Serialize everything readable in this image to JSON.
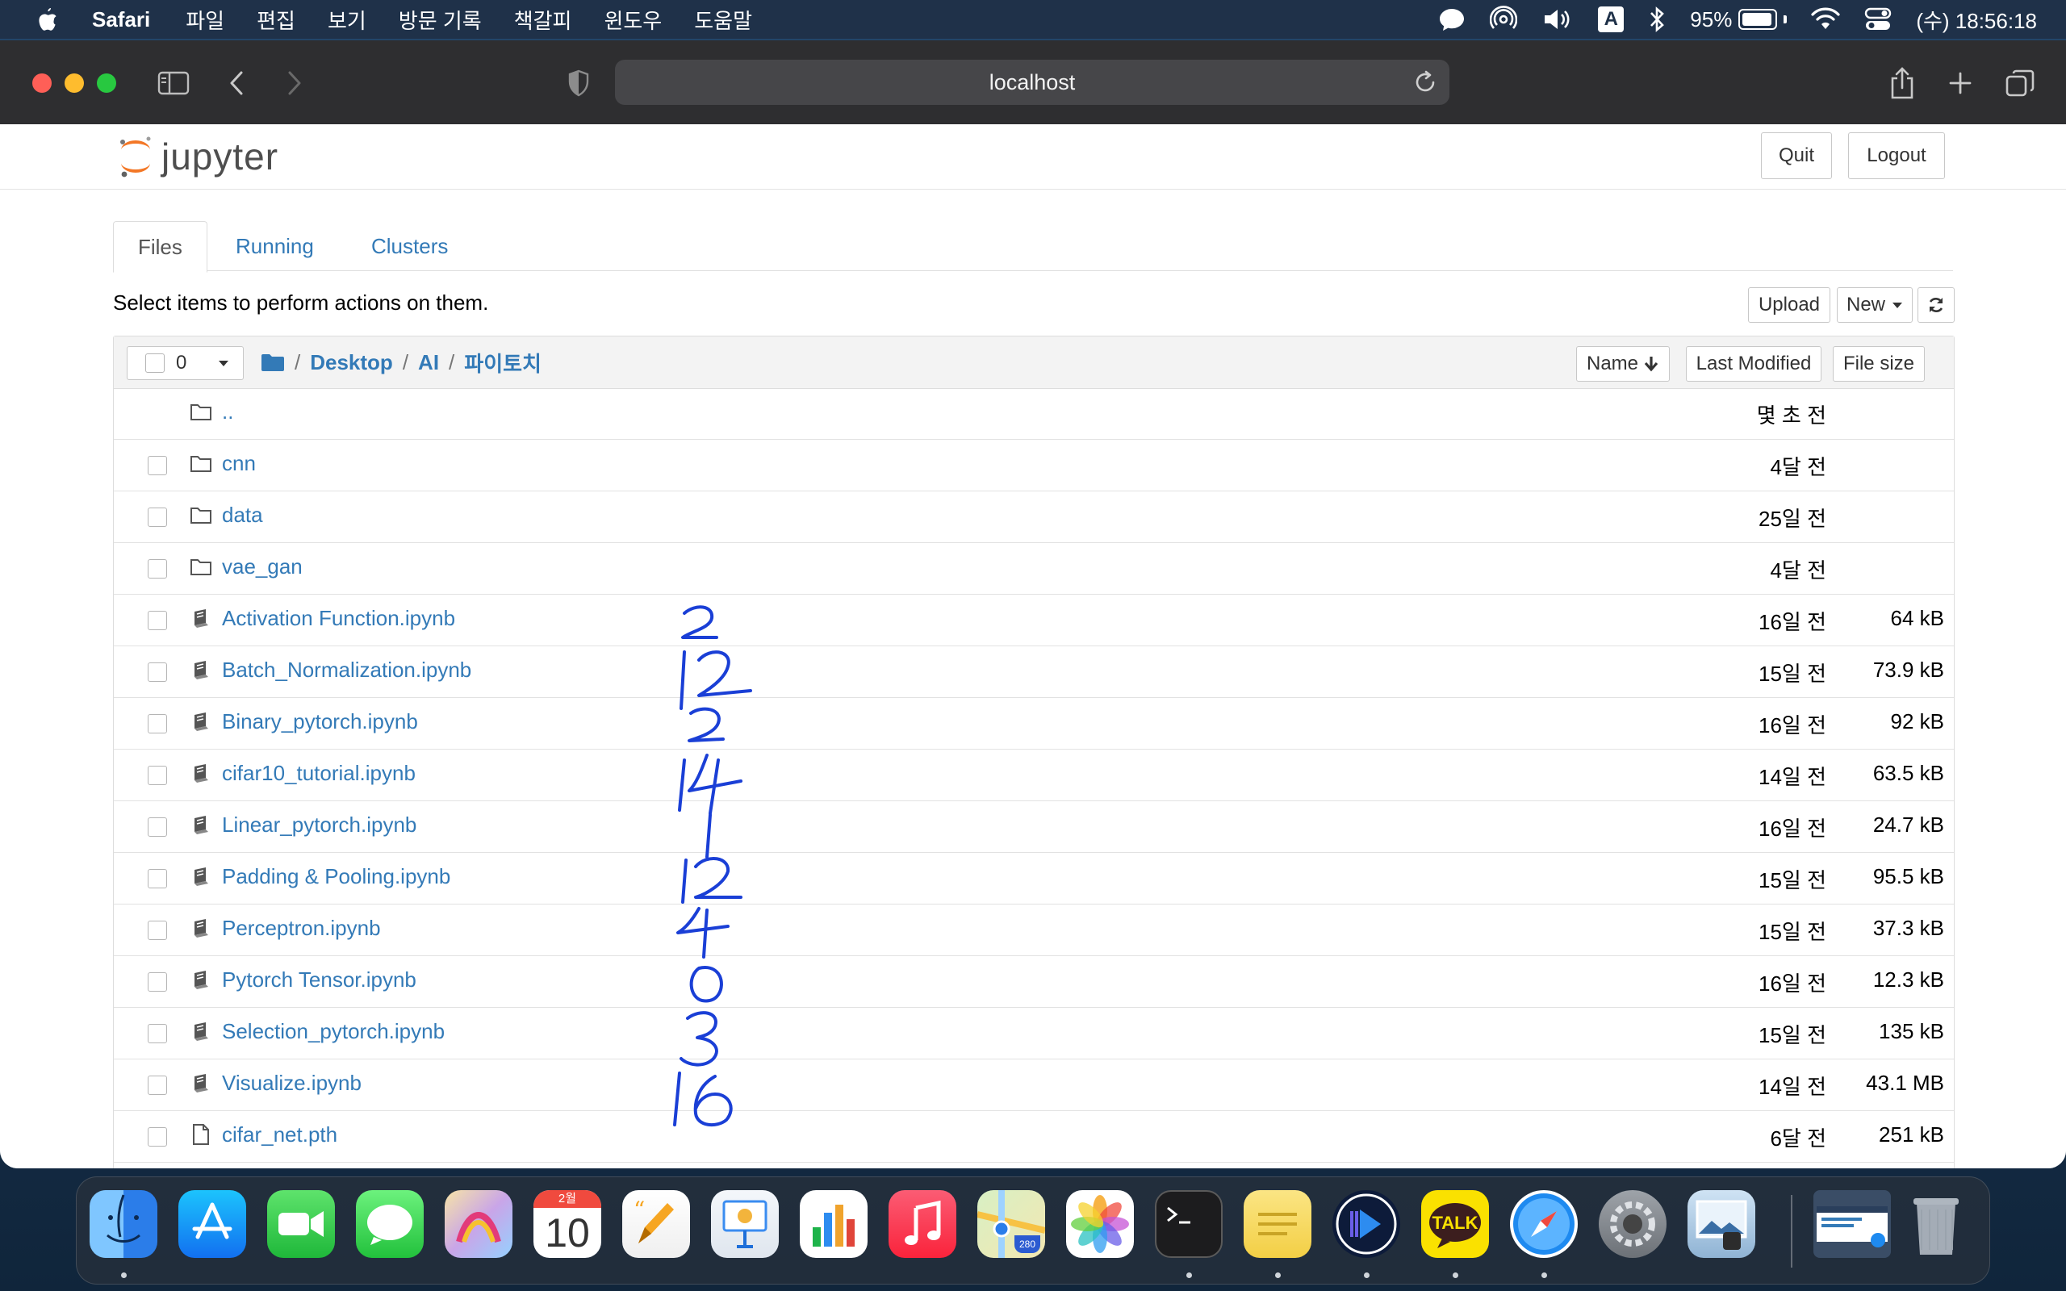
{
  "menubar": {
    "app_name": "Safari",
    "items": [
      "파일",
      "편집",
      "보기",
      "방문 기록",
      "책갈피",
      "윈도우",
      "도움말"
    ],
    "input_source": "A",
    "battery_percent": 95,
    "battery_label": "95%",
    "clock": "(수) 18:56:18"
  },
  "safari": {
    "address": "localhost"
  },
  "jupyter": {
    "logo_text": "jupyter",
    "quit_label": "Quit",
    "logout_label": "Logout",
    "tabs": [
      {
        "label": "Files",
        "active": true
      },
      {
        "label": "Running",
        "active": false
      },
      {
        "label": "Clusters",
        "active": false
      }
    ],
    "select_message": "Select items to perform actions on them.",
    "upload_label": "Upload",
    "new_label": "New",
    "selected_count": "0",
    "breadcrumb": [
      "Desktop",
      "AI",
      "파이토치"
    ],
    "sort": {
      "name": "Name",
      "last_modified": "Last Modified",
      "file_size": "File size"
    },
    "rows": [
      {
        "name": "..",
        "type": "folder",
        "modified": "몇 초 전",
        "size": "",
        "checkbox": false
      },
      {
        "name": "cnn",
        "type": "folder",
        "modified": "4달 전",
        "size": "",
        "checkbox": true
      },
      {
        "name": "data",
        "type": "folder",
        "modified": "25일 전",
        "size": "",
        "checkbox": true
      },
      {
        "name": "vae_gan",
        "type": "folder",
        "modified": "4달 전",
        "size": "",
        "checkbox": true
      },
      {
        "name": "Activation Function.ipynb",
        "type": "notebook",
        "modified": "16일 전",
        "size": "64 kB",
        "checkbox": true
      },
      {
        "name": "Batch_Normalization.ipynb",
        "type": "notebook",
        "modified": "15일 전",
        "size": "73.9 kB",
        "checkbox": true
      },
      {
        "name": "Binary_pytorch.ipynb",
        "type": "notebook",
        "modified": "16일 전",
        "size": "92 kB",
        "checkbox": true
      },
      {
        "name": "cifar10_tutorial.ipynb",
        "type": "notebook",
        "modified": "14일 전",
        "size": "63.5 kB",
        "checkbox": true
      },
      {
        "name": "Linear_pytorch.ipynb",
        "type": "notebook",
        "modified": "16일 전",
        "size": "24.7 kB",
        "checkbox": true
      },
      {
        "name": "Padding & Pooling.ipynb",
        "type": "notebook",
        "modified": "15일 전",
        "size": "95.5 kB",
        "checkbox": true
      },
      {
        "name": "Perceptron.ipynb",
        "type": "notebook",
        "modified": "15일 전",
        "size": "37.3 kB",
        "checkbox": true
      },
      {
        "name": "Pytorch Tensor.ipynb",
        "type": "notebook",
        "modified": "16일 전",
        "size": "12.3 kB",
        "checkbox": true
      },
      {
        "name": "Selection_pytorch.ipynb",
        "type": "notebook",
        "modified": "15일 전",
        "size": "135 kB",
        "checkbox": true
      },
      {
        "name": "Visualize.ipynb",
        "type": "notebook",
        "modified": "14일 전",
        "size": "43.1 MB",
        "checkbox": true
      },
      {
        "name": "cifar_net.pth",
        "type": "file",
        "modified": "6달 전",
        "size": "251 kB",
        "checkbox": true
      }
    ],
    "handwritten_numbers": [
      "2",
      "12",
      "2",
      "14",
      "1",
      "12",
      "4",
      "0",
      "3",
      "16"
    ]
  },
  "dock": {
    "calendar_month": "2월",
    "calendar_day": "10",
    "kakao_label": "TALK",
    "maps_shield": "280",
    "apps": [
      "finder-icon",
      "app-store-icon",
      "facetime-icon",
      "messages-icon",
      "grapher-icon",
      "calendar-icon",
      "pages-icon",
      "keynote-icon",
      "numbers-icon",
      "music-icon",
      "maps-icon",
      "photos-icon",
      "terminal-icon",
      "stickies-icon",
      "player-icon",
      "kakaotalk-icon",
      "safari-icon",
      "system-preferences-icon",
      "preview-icon"
    ],
    "colors": {
      "window_red": "#ff5f57",
      "window_yellow": "#febc2e",
      "window_green": "#28c840",
      "link": "#337ab7",
      "ink": "#1a3fd6"
    }
  }
}
